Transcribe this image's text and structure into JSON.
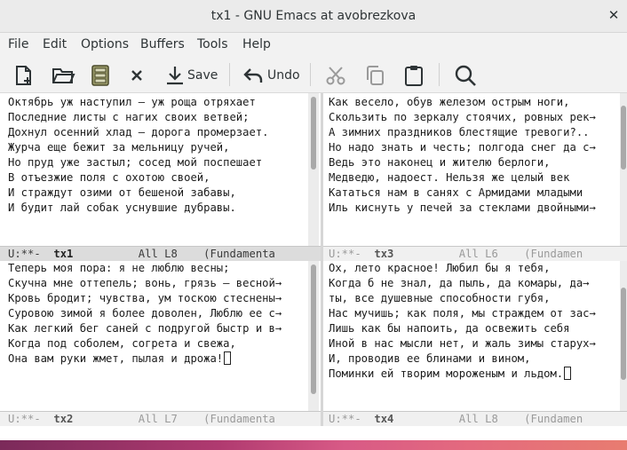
{
  "window": {
    "title": "tx1 - GNU Emacs at avobrezkova",
    "close_glyph": "✕"
  },
  "menu": [
    "File",
    "Edit",
    "Options",
    "Buffers",
    "Tools",
    "Help"
  ],
  "toolbar": {
    "new_file": "new-file-icon",
    "open": "open-folder-icon",
    "dired": "dired-icon",
    "kill": "close-buffer-icon",
    "save_label": "Save",
    "undo_label": "Undo",
    "cut": "cut-icon",
    "copy": "copy-icon",
    "paste": "paste-icon",
    "search": "search-icon"
  },
  "panes": {
    "tx1": {
      "lines": [
        "Октябрь уж наступил — уж роща отряхает",
        "Последние листы с нагих своих ветвей;",
        "Дохнул осенний хлад — дорога промерзает.",
        "Журча еще бежит за мельницу ручей,",
        "Но пруд уже застыл; сосед мой поспешает",
        "В отъезжие поля с охотою своей,",
        "И страждут озими от бешеной забавы,",
        "И будит лай собак уснувшие дубравы."
      ],
      "mode": {
        "status": "U:**-",
        "buffer": "tx1",
        "position": "All L8",
        "major": "(Fundamenta"
      }
    },
    "tx3": {
      "lines": [
        "Как весело, обув железом острым ноги,",
        "Скользить по зеркалу стоячих, ровных рек",
        "А зимних праздников блестящие тревоги?..",
        "Но надо знать и честь; полгода снег да с",
        "Ведь это наконец и жителю берлоги,",
        "Медведю, надоест. Нельзя же целый век",
        "Кататься нам в санях с Армидами младыми",
        "Иль киснуть у печей за стеклами двойными"
      ],
      "mode": {
        "status": "U:**-",
        "buffer": "tx3",
        "position": "All L6",
        "major": "(Fundamen"
      }
    },
    "tx2": {
      "lines": [
        "Теперь моя пора: я не люблю весны;",
        "Скучна мне оттепель; вонь, грязь — весной",
        "Кровь бродит; чувства, ум тоскою стеснены",
        "Суровою зимой я более доволен, Люблю ее с",
        "Как легкий бег саней с подругой быстр и в",
        "Когда под соболем, согрета и свежа,",
        "Она вам руки жмет, пылая и дрожа!"
      ],
      "mode": {
        "status": "U:**-",
        "buffer": "tx2",
        "position": "All L7",
        "major": "(Fundamenta"
      }
    },
    "tx4": {
      "lines": [
        "Ох, лето красное! Любил бы я тебя,",
        "Когда б не знал, да пыль, да комары, да",
        "ты, все душевные способности губя,",
        "Нас мучишь; как поля, мы страждем от зас",
        "Лишь как бы напоить, да освежить себя",
        "Иной в нас мысли нет, и жаль зимы старух",
        "И, проводив ее блинами и вином,",
        "Поминки ей творим мороженым и льдом."
      ],
      "mode": {
        "status": "U:**-",
        "buffer": "tx4",
        "position": "All L8",
        "major": "(Fundamen"
      }
    }
  },
  "continuation_glyph": "→"
}
